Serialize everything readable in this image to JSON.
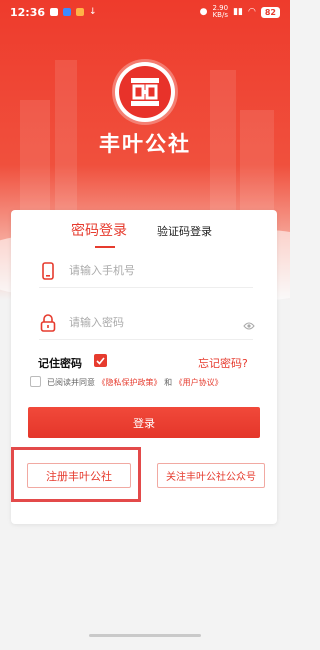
{
  "status_bar": {
    "time": "12:36",
    "net_speed": "2.90",
    "net_speed_unit": "KB/s",
    "battery": "82"
  },
  "app": {
    "name": "丰叶公社"
  },
  "tabs": {
    "password_login": "密码登录",
    "sms_login": "验证码登录"
  },
  "form": {
    "phone_placeholder": "请输入手机号",
    "password_placeholder": "请输入密码",
    "remember_label": "记住密码",
    "remember_checked": true,
    "forgot_label": "忘记密码?",
    "agree_prefix": "已阅读并同意",
    "privacy_link": "《隐私保护政策》",
    "and_text": "和",
    "user_agreement_link": "《用户协议》",
    "login_button": "登录"
  },
  "actions": {
    "register_button": "注册丰叶公社",
    "follow_button": "关注丰叶公社公众号"
  },
  "colors": {
    "brand_red": "#e63b2e",
    "highlight_border": "#e34a4a"
  }
}
